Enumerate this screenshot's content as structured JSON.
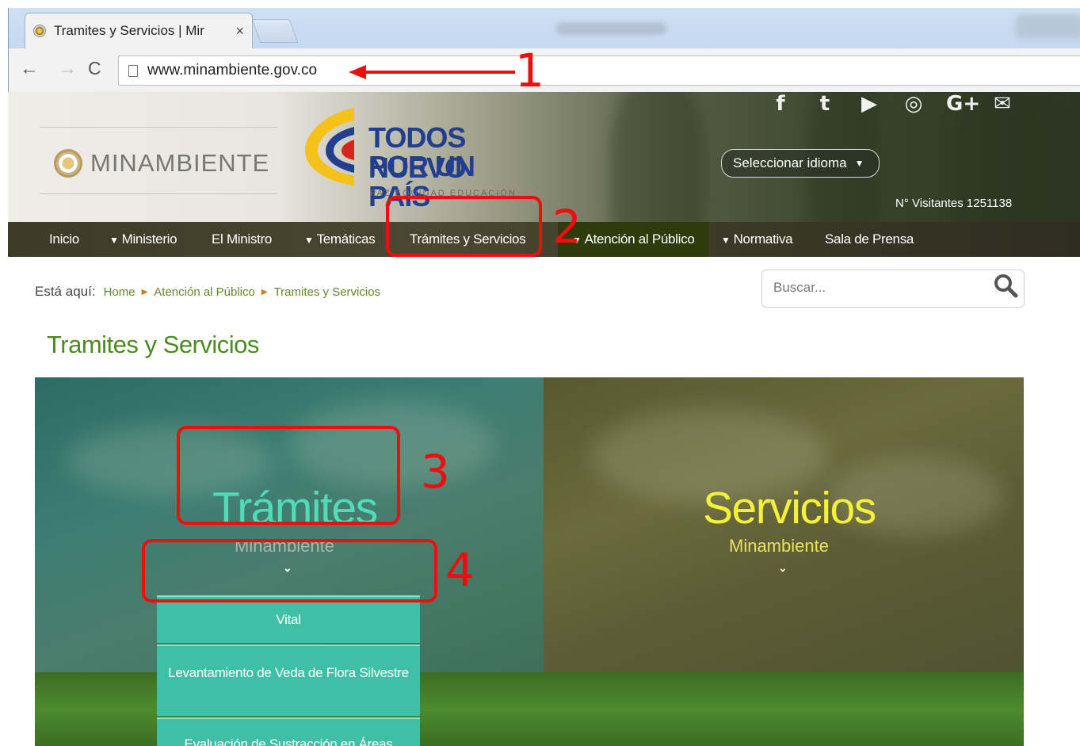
{
  "browser": {
    "tab_title": "Tramites y Servicios | Mir",
    "tab_close": "×",
    "url": "www.minambiente.gov.co",
    "back": "←",
    "forward": "→",
    "reload": "C"
  },
  "header": {
    "brand": "MINAMBIENTE",
    "campaign_line1": "TODOS POR UN",
    "campaign_line2": "NUEVO PAÍS",
    "campaign_tag": "PAZ  EQUIDAD  EDUCACIÓN",
    "social": [
      "f",
      "t",
      "▶",
      "◎",
      "G+",
      "✉"
    ],
    "language_select": "Seleccionar idioma",
    "language_caret": "▼",
    "visitors": "N° Visitantes 1251138"
  },
  "nav": {
    "items": [
      {
        "label": "Inicio",
        "caret": ""
      },
      {
        "label": "Ministerio",
        "caret": "▼"
      },
      {
        "label": "El Ministro",
        "caret": ""
      },
      {
        "label": "Temáticas",
        "caret": "▼"
      },
      {
        "label": "Trámites y Servicios",
        "caret": ""
      },
      {
        "label": "Atención al Público",
        "caret": "▼"
      },
      {
        "label": "Normativa",
        "caret": "▼"
      },
      {
        "label": "Sala de Prensa",
        "caret": ""
      }
    ]
  },
  "breadcrumb": {
    "label": "Está aquí:",
    "items": [
      "Home",
      "Atención al Público",
      "Tramites y Servicios"
    ],
    "separator": "▶"
  },
  "search": {
    "placeholder": "Buscar..."
  },
  "page_title": "Tramites y Servicios",
  "hero": {
    "tramites": {
      "title": "Trámites",
      "subtitle": "Minambiente",
      "chevron": "⌄"
    },
    "servicios": {
      "title": "Servicios",
      "subtitle": "Minambiente",
      "chevron": "⌄"
    },
    "dropdown": [
      "Vital",
      "Levantamiento de Veda de Flora Silvestre",
      "Evaluación de Sustracción en Áreas"
    ]
  },
  "annotations": [
    "1",
    "2",
    "3",
    "4"
  ],
  "colors": {
    "annotation_red": "#f00d0d",
    "tramites_accent": "#4fdcb9",
    "servicios_accent": "#f3f23a",
    "title_green": "#4c8a22",
    "dropdown_bg": "#3fbfa6"
  },
  "icons": {
    "search": "search-icon",
    "page": "page-icon",
    "favicon": "minambiente-favicon-icon"
  }
}
